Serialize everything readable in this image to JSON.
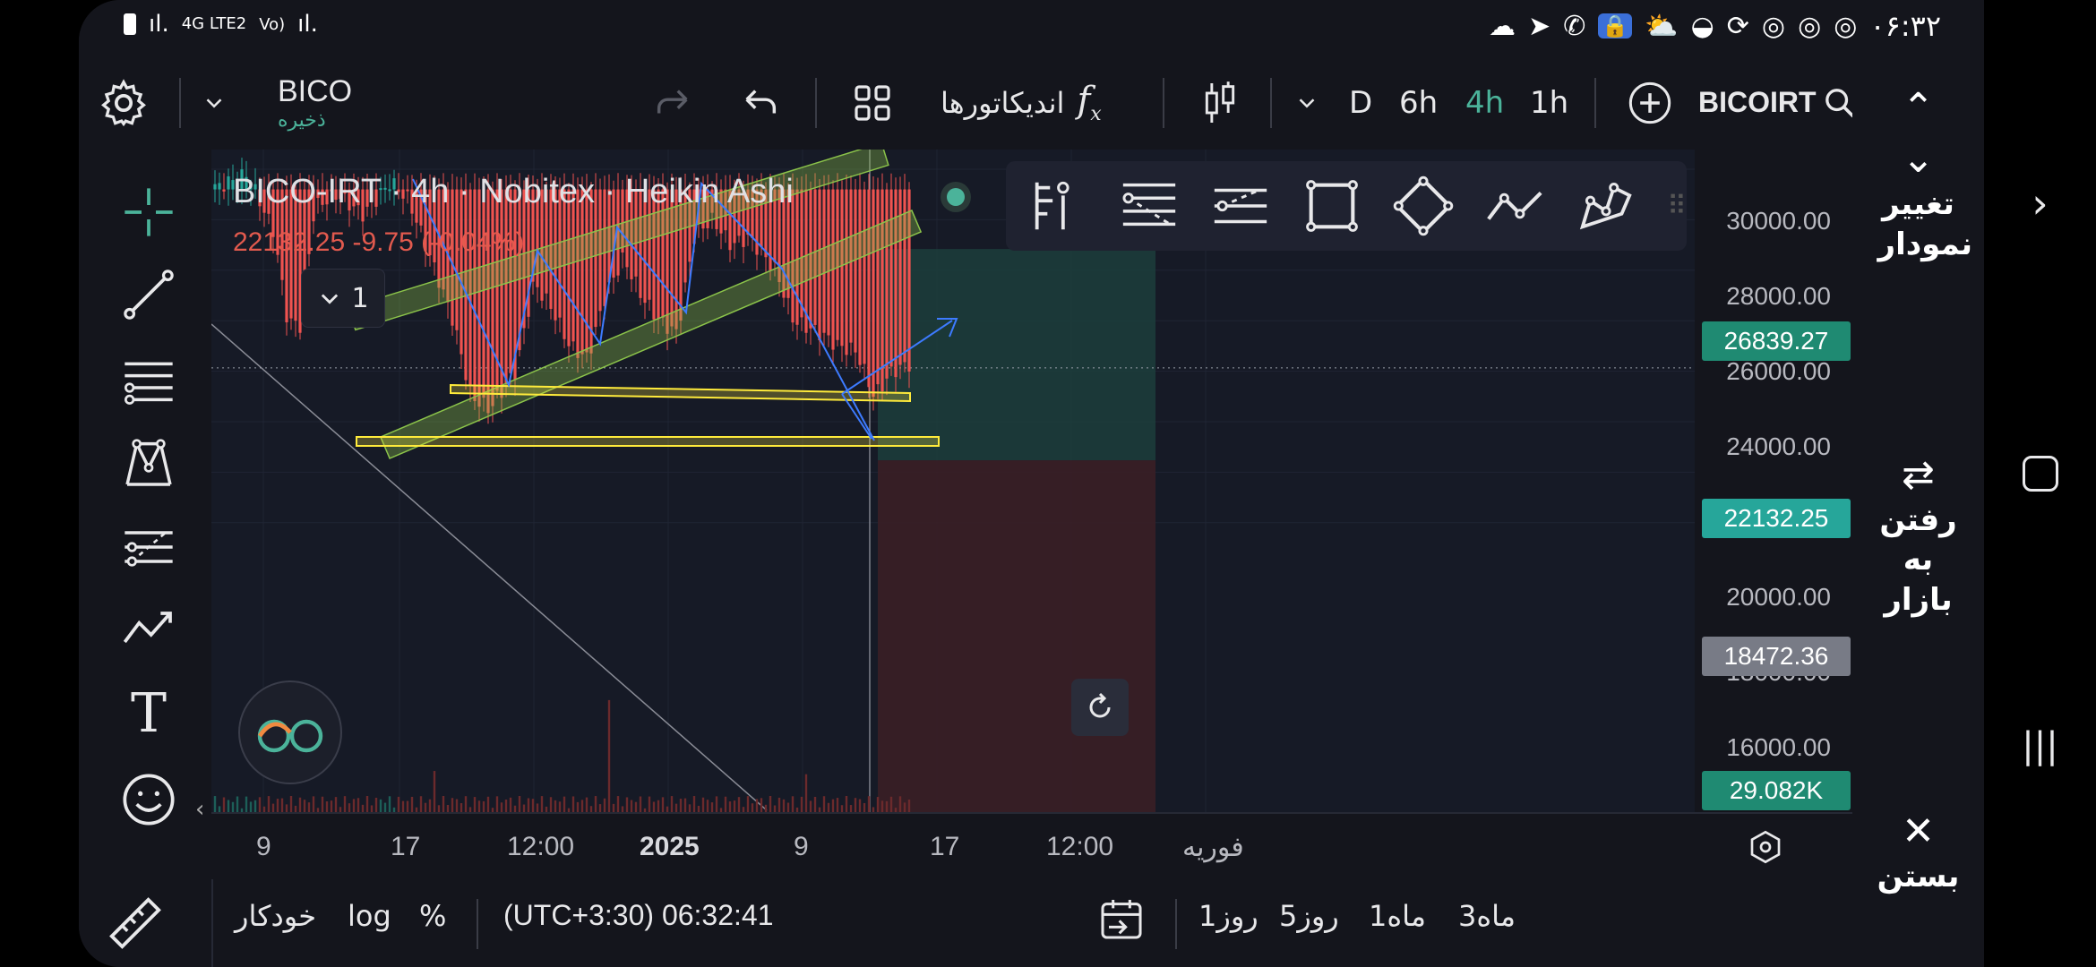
{
  "status_bar": {
    "network": "4G LTE2",
    "network_extra": "Vo)",
    "time": "۰۶:۳۲"
  },
  "toolbar": {
    "symbol": "BICO",
    "symbol_sub": "ذخیره",
    "indicators_label": "اندیکاتورها",
    "intervals": [
      "D",
      "6h",
      "4h",
      "1h"
    ],
    "active_interval": "4h",
    "search_symbol": "BICOIRT"
  },
  "legend": {
    "title": "BICO-IRT  · 4h · Nobitex · Heikin Ashi",
    "values": "22132.25  -9.75 (-0.04%)",
    "collapse_count": "1"
  },
  "price_axis": {
    "labels": [
      "30000.00",
      "28000.00",
      "26000.00",
      "24000.00",
      "20000.00",
      "18000.00",
      "16000.00"
    ],
    "tag_high": "26839.27",
    "tag_last": "22132.25",
    "tag_low": "18472.36",
    "tag_volume": "29.082K"
  },
  "time_axis": {
    "labels": [
      "9",
      "17",
      "12:00",
      "2025",
      "9",
      "17",
      "12:00",
      "فوریه"
    ]
  },
  "bottom_bar": {
    "auto": "خودکار",
    "log": "log",
    "percent": "%",
    "clock": "(UTC+3:30) 06:32:41",
    "ranges": [
      "1روز",
      "5روز",
      "1ماه",
      "3ماه"
    ]
  },
  "side_panel": {
    "change_chart": "تغییر نمودار",
    "go_market": "رفتن به بازار",
    "close": "بستن"
  },
  "colors": {
    "up": "#26a69a",
    "down": "#ef5350",
    "channel": "#8bc34a",
    "support": "#ffeb3b",
    "wave": "#3d7bff",
    "accent": "#4bb39a"
  }
}
